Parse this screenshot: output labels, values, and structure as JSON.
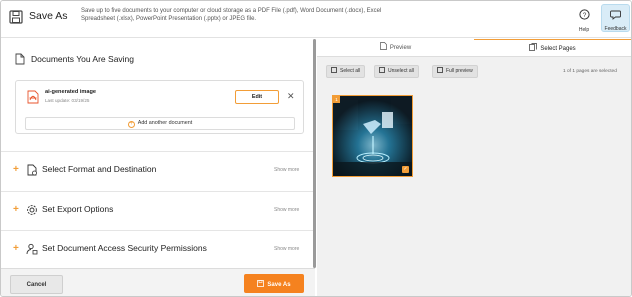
{
  "header": {
    "title": "Save As",
    "description": "Save up to five documents to your computer or cloud storage as a PDF File (.pdf), Word Document (.docx), Excel Spreadsheet (.xlsx), PowerPoint Presentation (.pptx) or JPEG file.",
    "help_label": "Help",
    "feedback_label": "Feedback"
  },
  "documents": {
    "section_title": "Documents You Are Saving",
    "items": [
      {
        "name": "ai-generated image",
        "last_update": "Last update: 03/19/25",
        "edit_label": "Edit"
      }
    ],
    "add_label": "Add another document"
  },
  "accordion": [
    {
      "label": "Select Format and Destination",
      "more": "Show more",
      "icon": "file-gear-icon"
    },
    {
      "label": "Set Export Options",
      "more": "Show more",
      "icon": "gear-icon"
    },
    {
      "label": "Set Document Access Security Permissions",
      "more": "Show more",
      "icon": "user-lock-icon"
    }
  ],
  "footer": {
    "cancel_label": "Cancel",
    "save_label": "Save As"
  },
  "right": {
    "tabs": [
      "Preview",
      "Select Pages"
    ],
    "active_tab": "Select Pages",
    "toolbar": {
      "select_all": "Select all",
      "unselect_all": "Unselect all",
      "full_preview": "Full preview"
    },
    "count_text": "1 of 1 pages are selected",
    "thumbnail": {
      "page_number": "1",
      "selected": true
    }
  },
  "colors": {
    "accent": "#f5821f",
    "accent_border": "#f29d37",
    "feedback_bg": "#d9ecf7"
  }
}
